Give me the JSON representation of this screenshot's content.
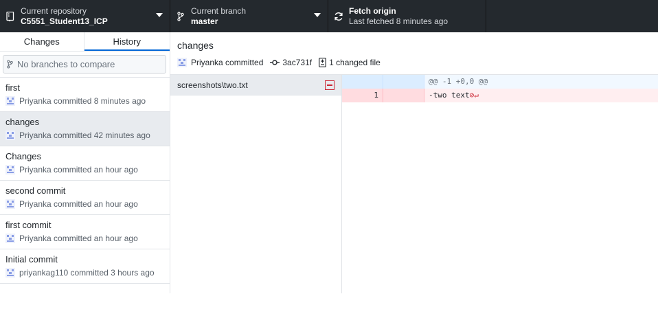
{
  "toolbar": {
    "repo": {
      "label": "Current repository",
      "value": "C5551_Student13_ICP"
    },
    "branch": {
      "label": "Current branch",
      "value": "master"
    },
    "fetch": {
      "label": "Fetch origin",
      "sub": "Last fetched 8 minutes ago"
    }
  },
  "sidebar": {
    "tabs": [
      {
        "label": "Changes"
      },
      {
        "label": "History"
      }
    ],
    "compare_placeholder": "No branches to compare",
    "commits": [
      {
        "title": "first",
        "meta": "Priyanka committed 8 minutes ago"
      },
      {
        "title": "changes",
        "meta": "Priyanka committed 42 minutes ago"
      },
      {
        "title": "Changes",
        "meta": "Priyanka committed an hour ago"
      },
      {
        "title": "second commit",
        "meta": "Priyanka committed an hour ago"
      },
      {
        "title": "first commit",
        "meta": "Priyanka committed an hour ago"
      },
      {
        "title": "Initial commit",
        "meta": "priyankag110 committed 3 hours ago"
      }
    ]
  },
  "commit": {
    "title": "changes",
    "author": "Priyanka committed",
    "sha": "3ac731f",
    "changed_files": "1 changed file"
  },
  "files": [
    {
      "path": "screenshots\\two.txt"
    }
  ],
  "diff": {
    "hunk": "@@ -1 +0,0 @@",
    "lines": [
      {
        "old": "1",
        "new": "",
        "text": "-two text"
      }
    ],
    "no_newline_marker": "⊘↵"
  },
  "colors": {
    "toolbar_bg": "#24292e",
    "selection": "#e8ebef",
    "deleted": "#ffeef0",
    "hunk": "#f1f8ff"
  }
}
